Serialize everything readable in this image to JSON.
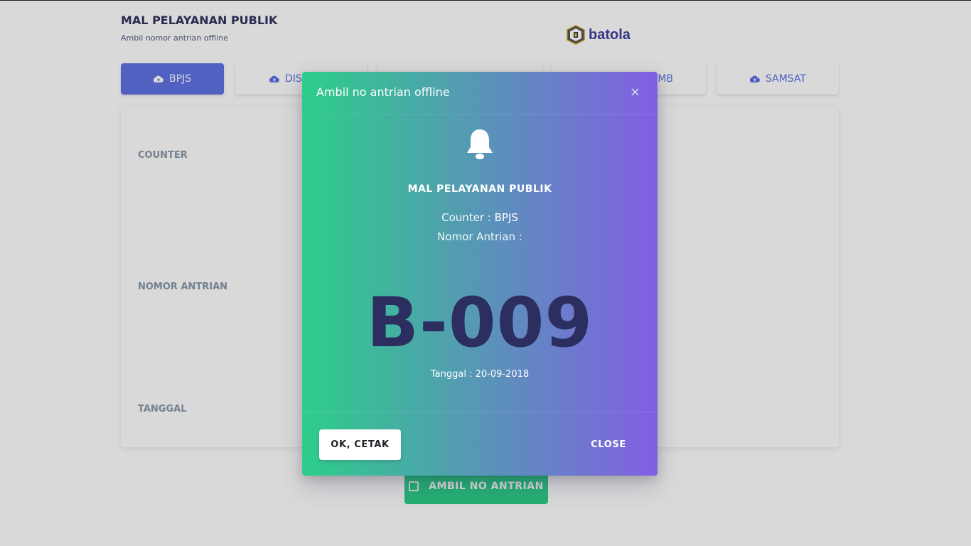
{
  "page": {
    "title": "MAL PELAYANAN PUBLIK",
    "subtitle": "Ambil nomor antrian offline",
    "logo_text": "batola"
  },
  "tabs": [
    {
      "label": "BPJS",
      "active": true
    },
    {
      "label": "DISDUKCAPIL",
      "visible_text": "DIS",
      "active": false
    },
    {
      "label": "",
      "active": false
    },
    {
      "label": "IMB",
      "visible_text": "MB",
      "active": false
    },
    {
      "label": "SAMSAT",
      "active": false
    }
  ],
  "card": {
    "labels": {
      "counter": "COUNTER",
      "queue_number": "NOMOR ANTRIAN",
      "date": "TANGGAL"
    }
  },
  "take_button": {
    "label": "AMBIL NO ANTRIAN"
  },
  "modal": {
    "title": "Ambil no antrian offline",
    "close_x": "×",
    "heading": "MAL PELAYANAN PUBLIK",
    "counter_label": "Counter : ",
    "counter_value": "BPJS",
    "queue_label": "Nomor Antrian :",
    "queue_number": "B-009",
    "date_text": "Tanggal : 20-09-2018",
    "ok_button": "OK, CETAK",
    "close_button": "CLOSE"
  },
  "colors": {
    "primary": "#5e72e4",
    "success": "#2dce89",
    "gradient_start": "#2dce89",
    "gradient_end": "#825ee4",
    "number_color": "#2b2e5e"
  },
  "icons": {
    "tab_icon": "cloud-upload-icon",
    "modal_icon": "bell-icon",
    "take_button_icon": "bag-icon"
  }
}
